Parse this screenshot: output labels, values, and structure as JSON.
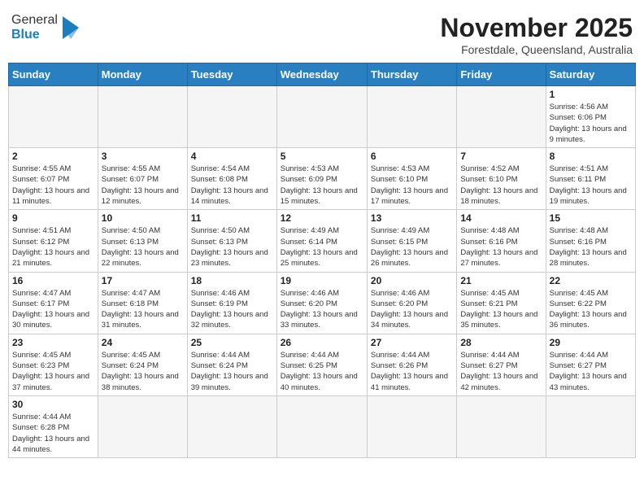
{
  "header": {
    "logo_general": "General",
    "logo_blue": "Blue",
    "month": "November 2025",
    "location": "Forestdale, Queensland, Australia"
  },
  "weekdays": [
    "Sunday",
    "Monday",
    "Tuesday",
    "Wednesday",
    "Thursday",
    "Friday",
    "Saturday"
  ],
  "weeks": [
    [
      {
        "day": null
      },
      {
        "day": null
      },
      {
        "day": null
      },
      {
        "day": null
      },
      {
        "day": null
      },
      {
        "day": null
      },
      {
        "day": "1",
        "sunrise": "4:56 AM",
        "sunset": "6:06 PM",
        "daylight": "13 hours and 9 minutes."
      }
    ],
    [
      {
        "day": "2",
        "sunrise": "4:55 AM",
        "sunset": "6:07 PM",
        "daylight": "13 hours and 11 minutes."
      },
      {
        "day": "3",
        "sunrise": "4:55 AM",
        "sunset": "6:07 PM",
        "daylight": "13 hours and 12 minutes."
      },
      {
        "day": "4",
        "sunrise": "4:54 AM",
        "sunset": "6:08 PM",
        "daylight": "13 hours and 14 minutes."
      },
      {
        "day": "5",
        "sunrise": "4:53 AM",
        "sunset": "6:09 PM",
        "daylight": "13 hours and 15 minutes."
      },
      {
        "day": "6",
        "sunrise": "4:53 AM",
        "sunset": "6:10 PM",
        "daylight": "13 hours and 17 minutes."
      },
      {
        "day": "7",
        "sunrise": "4:52 AM",
        "sunset": "6:10 PM",
        "daylight": "13 hours and 18 minutes."
      },
      {
        "day": "8",
        "sunrise": "4:51 AM",
        "sunset": "6:11 PM",
        "daylight": "13 hours and 19 minutes."
      }
    ],
    [
      {
        "day": "9",
        "sunrise": "4:51 AM",
        "sunset": "6:12 PM",
        "daylight": "13 hours and 21 minutes."
      },
      {
        "day": "10",
        "sunrise": "4:50 AM",
        "sunset": "6:13 PM",
        "daylight": "13 hours and 22 minutes."
      },
      {
        "day": "11",
        "sunrise": "4:50 AM",
        "sunset": "6:13 PM",
        "daylight": "13 hours and 23 minutes."
      },
      {
        "day": "12",
        "sunrise": "4:49 AM",
        "sunset": "6:14 PM",
        "daylight": "13 hours and 25 minutes."
      },
      {
        "day": "13",
        "sunrise": "4:49 AM",
        "sunset": "6:15 PM",
        "daylight": "13 hours and 26 minutes."
      },
      {
        "day": "14",
        "sunrise": "4:48 AM",
        "sunset": "6:16 PM",
        "daylight": "13 hours and 27 minutes."
      },
      {
        "day": "15",
        "sunrise": "4:48 AM",
        "sunset": "6:16 PM",
        "daylight": "13 hours and 28 minutes."
      }
    ],
    [
      {
        "day": "16",
        "sunrise": "4:47 AM",
        "sunset": "6:17 PM",
        "daylight": "13 hours and 30 minutes."
      },
      {
        "day": "17",
        "sunrise": "4:47 AM",
        "sunset": "6:18 PM",
        "daylight": "13 hours and 31 minutes."
      },
      {
        "day": "18",
        "sunrise": "4:46 AM",
        "sunset": "6:19 PM",
        "daylight": "13 hours and 32 minutes."
      },
      {
        "day": "19",
        "sunrise": "4:46 AM",
        "sunset": "6:20 PM",
        "daylight": "13 hours and 33 minutes."
      },
      {
        "day": "20",
        "sunrise": "4:46 AM",
        "sunset": "6:20 PM",
        "daylight": "13 hours and 34 minutes."
      },
      {
        "day": "21",
        "sunrise": "4:45 AM",
        "sunset": "6:21 PM",
        "daylight": "13 hours and 35 minutes."
      },
      {
        "day": "22",
        "sunrise": "4:45 AM",
        "sunset": "6:22 PM",
        "daylight": "13 hours and 36 minutes."
      }
    ],
    [
      {
        "day": "23",
        "sunrise": "4:45 AM",
        "sunset": "6:23 PM",
        "daylight": "13 hours and 37 minutes."
      },
      {
        "day": "24",
        "sunrise": "4:45 AM",
        "sunset": "6:24 PM",
        "daylight": "13 hours and 38 minutes."
      },
      {
        "day": "25",
        "sunrise": "4:44 AM",
        "sunset": "6:24 PM",
        "daylight": "13 hours and 39 minutes."
      },
      {
        "day": "26",
        "sunrise": "4:44 AM",
        "sunset": "6:25 PM",
        "daylight": "13 hours and 40 minutes."
      },
      {
        "day": "27",
        "sunrise": "4:44 AM",
        "sunset": "6:26 PM",
        "daylight": "13 hours and 41 minutes."
      },
      {
        "day": "28",
        "sunrise": "4:44 AM",
        "sunset": "6:27 PM",
        "daylight": "13 hours and 42 minutes."
      },
      {
        "day": "29",
        "sunrise": "4:44 AM",
        "sunset": "6:27 PM",
        "daylight": "13 hours and 43 minutes."
      }
    ],
    [
      {
        "day": "30",
        "sunrise": "4:44 AM",
        "sunset": "6:28 PM",
        "daylight": "13 hours and 44 minutes."
      },
      {
        "day": null
      },
      {
        "day": null
      },
      {
        "day": null
      },
      {
        "day": null
      },
      {
        "day": null
      },
      {
        "day": null
      }
    ]
  ]
}
